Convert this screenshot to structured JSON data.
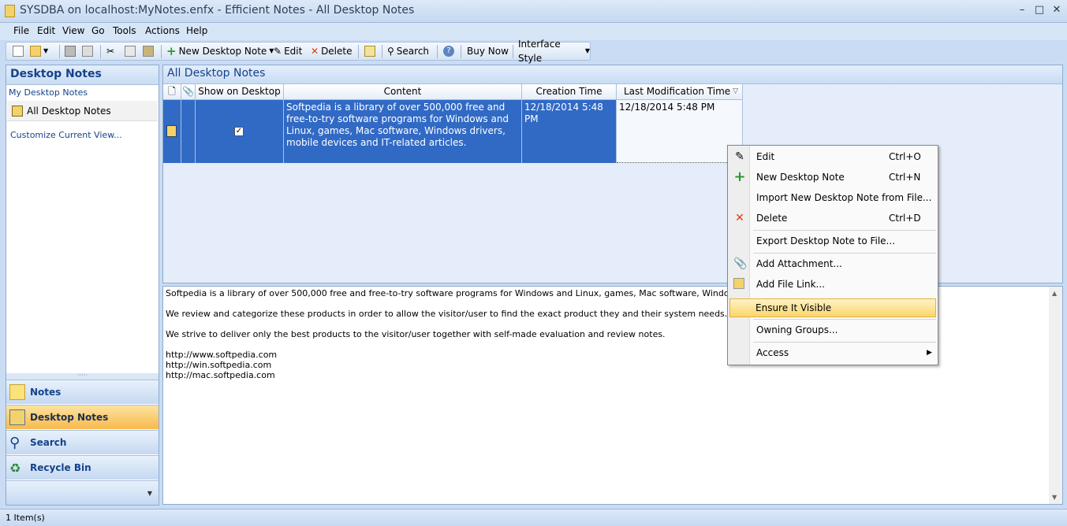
{
  "window": {
    "title": "SYSDBA on localhost:MyNotes.enfx - Efficient Notes - All Desktop Notes"
  },
  "menu": [
    "File",
    "Edit",
    "View",
    "Go",
    "Tools",
    "Actions",
    "Help"
  ],
  "toolbar": {
    "new_desktop_note": "New Desktop Note",
    "edit": "Edit",
    "delete": "Delete",
    "search": "Search",
    "buy_now": "Buy Now",
    "interface_style": "Interface Style"
  },
  "left_pane": {
    "title": "Desktop Notes",
    "section": "My Desktop Notes",
    "selected_item": "All Desktop Notes",
    "customize": "Customize Current View...",
    "nav": [
      "Notes",
      "Desktop Notes",
      "Search",
      "Recycle Bin"
    ]
  },
  "grid": {
    "title": "All Desktop Notes",
    "columns": {
      "show_on_desktop": "Show on Desktop",
      "content": "Content",
      "creation": "Creation Time",
      "modified": "Last Modification Time"
    },
    "row": {
      "content": "Softpedia is a library of over 500,000 free and free-to-try software programs for Windows and Linux, games, Mac software, Windows drivers, mobile devices and IT-related articles.",
      "creation": "12/18/2014 5:48 PM",
      "modified": "12/18/2014 5:48 PM",
      "show_on_desktop": true
    }
  },
  "preview": {
    "p1": "Softpedia is a library of over 500,000 free and free-to-try software programs for Windows and Linux, games, Mac software, Windows drivers, mobile devi",
    "p2": "We review and categorize these products in order to allow the visitor/user to find the exact product they and their system needs.",
    "p3": "We strive to deliver only the best products to the visitor/user together with self-made evaluation and review notes.",
    "links": [
      "http://www.softpedia.com",
      "http://win.softpedia.com",
      "http://mac.softpedia.com"
    ]
  },
  "context_menu": {
    "edit": "Edit",
    "edit_sc": "Ctrl+O",
    "new": "New Desktop Note",
    "new_sc": "Ctrl+N",
    "import": "Import New Desktop Note from File...",
    "delete": "Delete",
    "delete_sc": "Ctrl+D",
    "export": "Export Desktop Note to File...",
    "attach": "Add Attachment...",
    "file_link": "Add File Link...",
    "ensure": "Ensure It Visible",
    "groups": "Owning Groups...",
    "access": "Access"
  },
  "status": {
    "count": "1 Item(s)"
  },
  "colors": {
    "selection": "#316ac5",
    "highlight": "#fbd66b",
    "header_text": "#15428b"
  }
}
